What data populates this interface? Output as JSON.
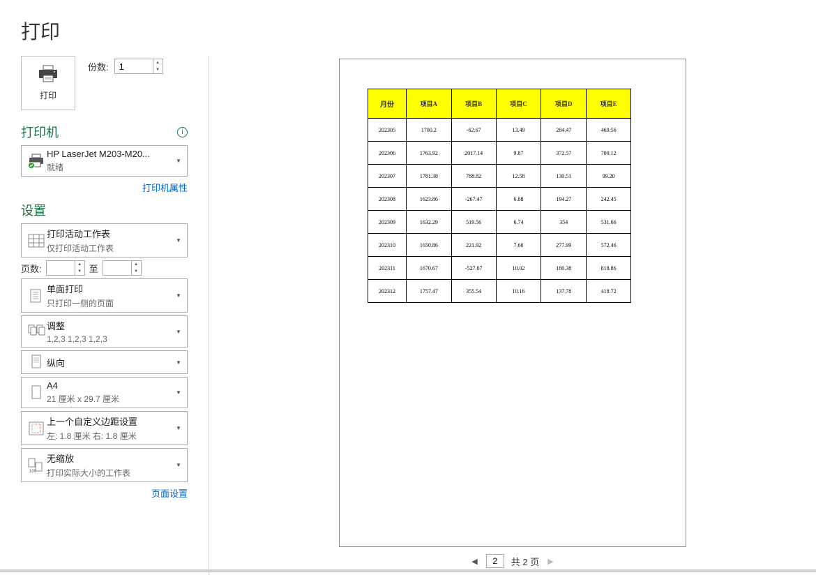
{
  "title": "打印",
  "print_button": "打印",
  "copies": {
    "label": "份数:",
    "value": "1"
  },
  "printer": {
    "section_title": "打印机",
    "name": "HP LaserJet M203-M20...",
    "status": "就绪",
    "properties_link": "打印机属性"
  },
  "settings": {
    "section_title": "设置",
    "scope": {
      "title": "打印活动工作表",
      "sub": "仅打印活动工作表"
    },
    "pages": {
      "label": "页数:",
      "to_label": "至",
      "from": "",
      "to": ""
    },
    "sides": {
      "title": "单面打印",
      "sub": "只打印一侧的页面"
    },
    "collate": {
      "title": "调整",
      "sub": "1,2,3    1,2,3    1,2,3"
    },
    "orientation": {
      "title": "纵向"
    },
    "paper": {
      "title": "A4",
      "sub": "21 厘米 x 29.7 厘米"
    },
    "margins": {
      "title": "上一个自定义边距设置",
      "sub": "左:  1.8 厘米    右:  1.8 厘米"
    },
    "scaling": {
      "title": "无缩放",
      "sub": "打印实际大小的工作表"
    },
    "page_setup_link": "页面设置"
  },
  "pager": {
    "current": "2",
    "total_label": "共 2 页"
  },
  "preview_table": {
    "headers": [
      "月份",
      "项目A",
      "项目B",
      "项目C",
      "项目D",
      "项目E"
    ],
    "rows": [
      [
        "202305",
        "1700.2",
        "-62.67",
        "13.49",
        "284.47",
        "469.56"
      ],
      [
        "202306",
        "1763.92",
        "2017.14",
        "9.87",
        "372.57",
        "700.12"
      ],
      [
        "202307",
        "1781.38",
        "788.82",
        "12.58",
        "130.51",
        "99.20"
      ],
      [
        "202308",
        "1623.86",
        "-267.47",
        "6.88",
        "194.27",
        "242.45"
      ],
      [
        "202309",
        "1632.29",
        "519.56",
        "6.74",
        "354",
        "531.66"
      ],
      [
        "202310",
        "1650.86",
        "221.92",
        "7.66",
        "277.99",
        "572.46"
      ],
      [
        "202311",
        "1670.67",
        "-527.07",
        "10.02",
        "180.38",
        "818.86"
      ],
      [
        "202312",
        "1757.47",
        "355.54",
        "10.16",
        "137.78",
        "418.72"
      ]
    ]
  }
}
